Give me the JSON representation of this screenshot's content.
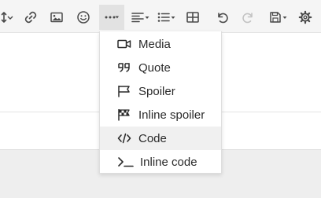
{
  "toolbar": {
    "buttons": [
      {
        "icon": "text-height-icon",
        "state": "normal"
      },
      {
        "icon": "link-icon",
        "state": "normal"
      },
      {
        "icon": "image-icon",
        "state": "normal"
      },
      {
        "icon": "smiley-icon",
        "state": "normal"
      },
      {
        "icon": "more-insert-icon",
        "state": "active"
      },
      {
        "icon": "align-icon",
        "state": "normal"
      },
      {
        "icon": "list-icon",
        "state": "normal"
      },
      {
        "icon": "table-icon",
        "state": "normal"
      },
      {
        "icon": "undo-icon",
        "state": "normal"
      },
      {
        "icon": "redo-icon",
        "state": "disabled"
      },
      {
        "icon": "save-draft-icon",
        "state": "normal"
      },
      {
        "icon": "gear-icon",
        "state": "normal"
      }
    ]
  },
  "insert_menu": {
    "items": [
      {
        "label": "Media",
        "icon": "video-icon"
      },
      {
        "label": "Quote",
        "icon": "quote-icon"
      },
      {
        "label": "Spoiler",
        "icon": "flag-icon"
      },
      {
        "label": "Inline spoiler",
        "icon": "checkered-flag-icon"
      },
      {
        "label": "Code",
        "icon": "code-icon",
        "highlighted": true
      },
      {
        "label": "Inline code",
        "icon": "terminal-icon"
      }
    ]
  },
  "colors": {
    "toolbar_bg": "#f5f5f5",
    "active_button_bg": "#e2e2e2",
    "menu_hover_bg": "#f0f0f0",
    "footer_bg": "#eeeeee"
  }
}
